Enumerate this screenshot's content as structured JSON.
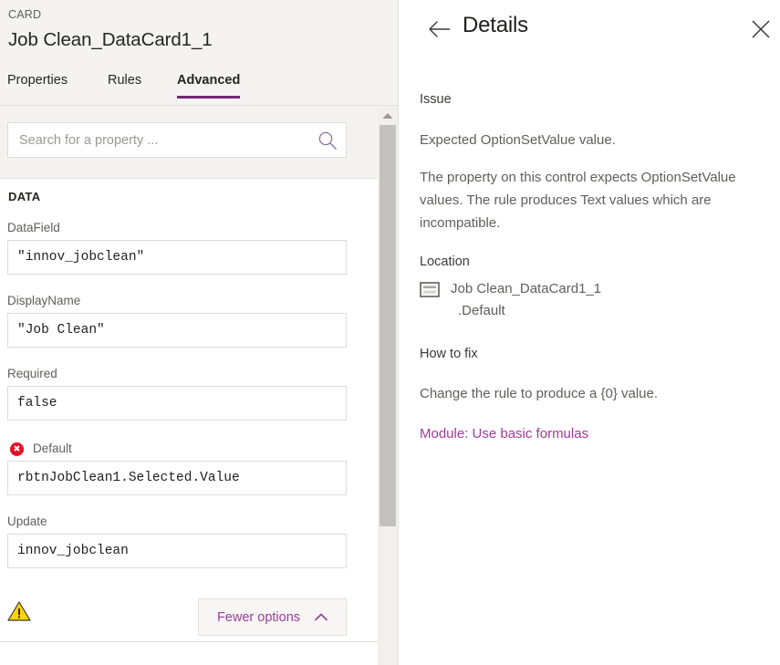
{
  "left_panel": {
    "kicker": "CARD",
    "title": "Job Clean_DataCard1_1",
    "tabs": [
      {
        "label": "Properties",
        "active": false
      },
      {
        "label": "Rules",
        "active": false
      },
      {
        "label": "Advanced",
        "active": true
      }
    ],
    "search": {
      "placeholder": "Search for a property ...",
      "value": "",
      "icon": "search-icon"
    },
    "section_label": "DATA",
    "fields": [
      {
        "label": "DataField",
        "value": "\"innov_jobclean\"",
        "has_error": false
      },
      {
        "label": "DisplayName",
        "value": "\"Job Clean\"",
        "has_error": false
      },
      {
        "label": "Required",
        "value": "false",
        "has_error": false
      },
      {
        "label": "Default",
        "value": "rbtnJobClean1.Selected.Value",
        "has_error": true
      },
      {
        "label": "Update",
        "value": "innov_jobclean",
        "has_error": false
      }
    ],
    "footer": {
      "warning_icon": "warning-triangle-icon",
      "fewer_options_label": "Fewer options",
      "fewer_options_icon": "chevron-up-icon"
    },
    "scrollbar": {
      "up_arrow_icon": "caret-up-icon"
    }
  },
  "right_panel": {
    "back_icon": "back-arrow-icon",
    "title": "Details",
    "close_icon": "close-icon",
    "issue_heading": "Issue",
    "issue_summary": "Expected OptionSetValue value.",
    "issue_body": "The property on this control expects OptionSetValue values. The rule produces Text values which are incompatible.",
    "location_heading": "Location",
    "location_icon": "card-control-icon",
    "location_control": "Job Clean_DataCard1_1",
    "location_property": ".Default",
    "howtofix_heading": "How to fix",
    "howtofix_body": "Change the rule to produce a {0} value.",
    "module_link": "Module: Use basic formulas"
  },
  "colors": {
    "accent_purple": "#742774",
    "link_purple": "#a4379a",
    "error_red": "#e81123",
    "warning_yellow": "#ffd400",
    "panel_gray": "#f4f3f2"
  }
}
